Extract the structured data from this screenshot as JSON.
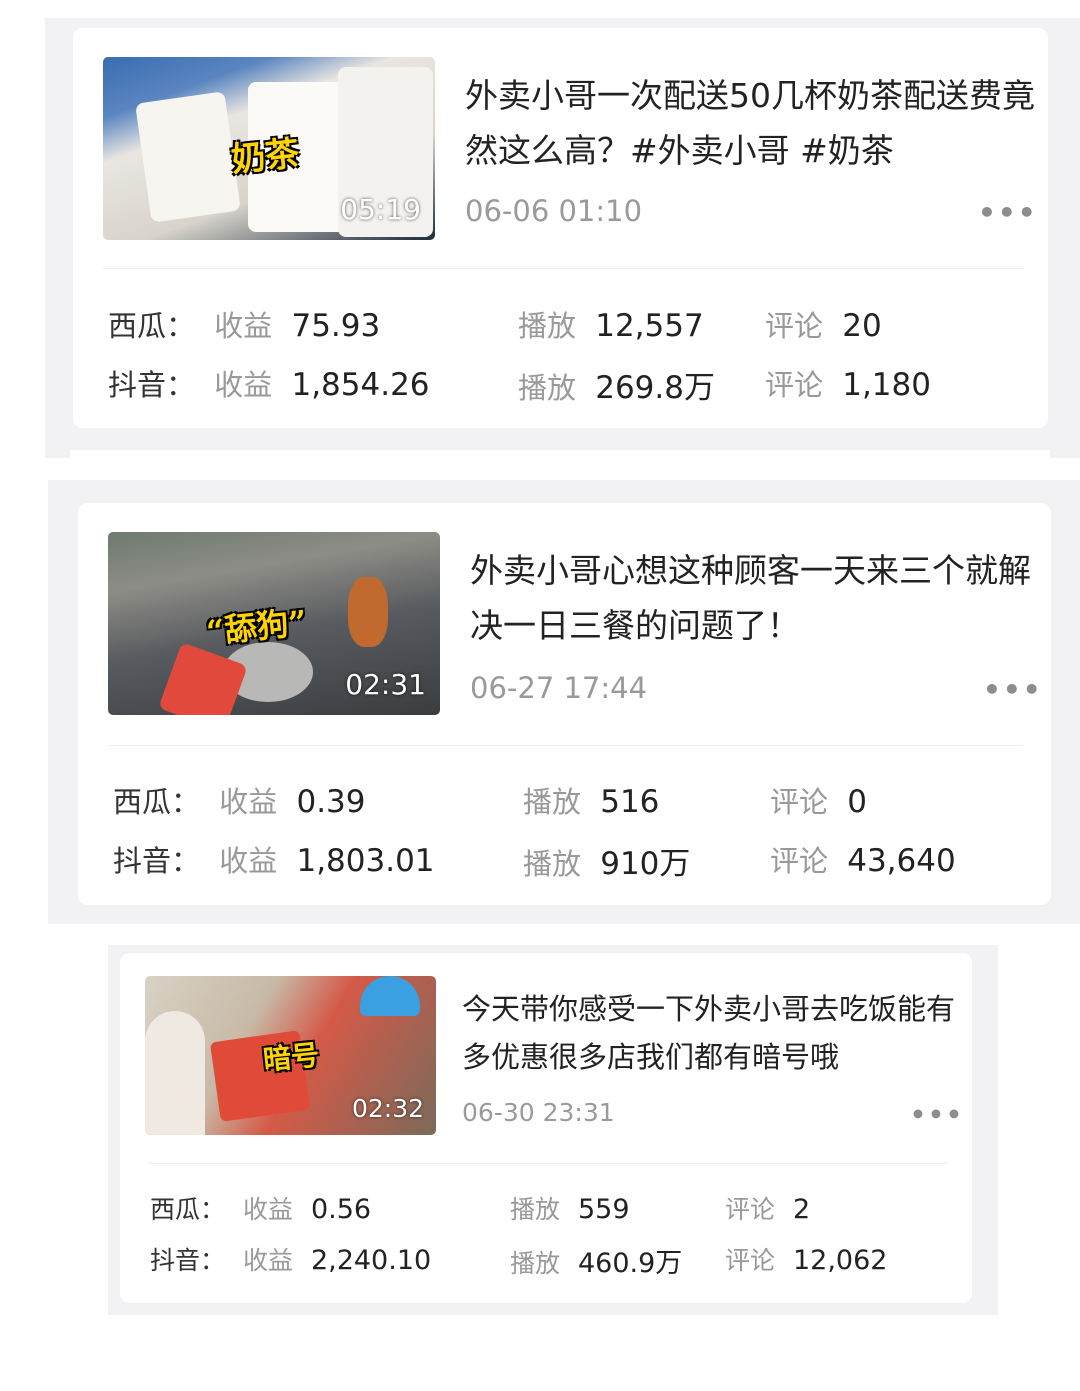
{
  "videos": [
    {
      "thumbnail": {
        "caption": "奶茶",
        "duration": "05:19"
      },
      "title": "外卖小哥一次配送50几杯奶茶配送费竟然这么高？#外卖小哥 #奶茶",
      "date": "06-06 01:10",
      "more_icon": "more-dots-icon",
      "rows": [
        {
          "platform": "西瓜：",
          "income_label": "收益",
          "income": "75.93",
          "play_label": "播放",
          "plays": "12,557",
          "comment_label": "评论",
          "comments": "20"
        },
        {
          "platform": "抖音：",
          "income_label": "收益",
          "income": "1,854.26",
          "play_label": "播放",
          "plays": "269.8万",
          "comment_label": "评论",
          "comments": "1,180"
        }
      ]
    },
    {
      "thumbnail": {
        "caption": "“舔狗”",
        "duration": "02:31"
      },
      "title": "外卖小哥心想这种顾客一天来三个就解决一日三餐的问题了！",
      "date": "06-27 17:44",
      "more_icon": "more-dots-icon",
      "rows": [
        {
          "platform": "西瓜：",
          "income_label": "收益",
          "income": "0.39",
          "play_label": "播放",
          "plays": "516",
          "comment_label": "评论",
          "comments": "0"
        },
        {
          "platform": "抖音：",
          "income_label": "收益",
          "income": "1,803.01",
          "play_label": "播放",
          "plays": "910万",
          "comment_label": "评论",
          "comments": "43,640"
        }
      ]
    },
    {
      "thumbnail": {
        "caption": "暗号",
        "duration": "02:32"
      },
      "title": "今天带你感受一下外卖小哥去吃饭能有多优惠很多店我们都有暗号哦",
      "date": "06-30 23:31",
      "more_icon": "more-dots-icon",
      "rows": [
        {
          "platform": "西瓜：",
          "income_label": "收益",
          "income": "0.56",
          "play_label": "播放",
          "plays": "559",
          "comment_label": "评论",
          "comments": "2"
        },
        {
          "platform": "抖音：",
          "income_label": "收益",
          "income": "2,240.10",
          "play_label": "播放",
          "plays": "460.9万",
          "comment_label": "评论",
          "comments": "12,062"
        }
      ]
    }
  ],
  "colors": {
    "caption": "#ffd400",
    "text": "#222222",
    "muted": "#999999",
    "panel": "#f2f2f4"
  },
  "more_glyph": "•••"
}
